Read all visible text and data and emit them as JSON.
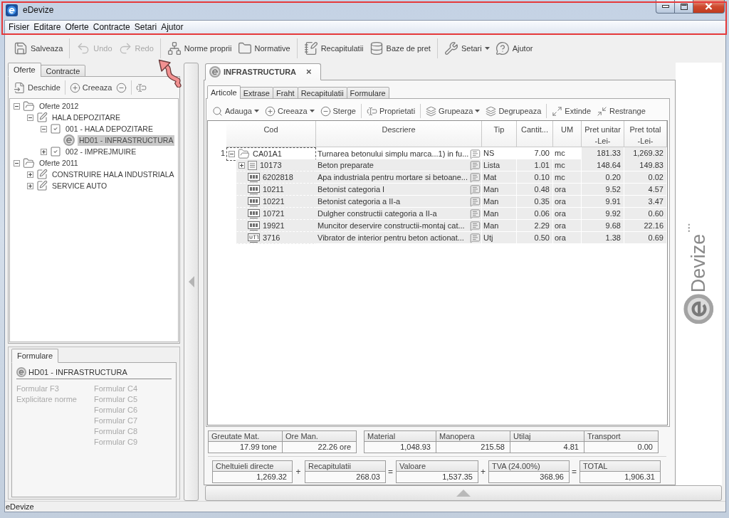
{
  "window": {
    "title": "eDevize"
  },
  "menu": [
    {
      "label": "Fisier"
    },
    {
      "label": "Editare"
    },
    {
      "label": "Oferte"
    },
    {
      "label": "Contracte"
    },
    {
      "label": "Setari"
    },
    {
      "label": "Ajutor"
    }
  ],
  "toolbar": [
    [
      {
        "label": "Salveaza",
        "disabled": false,
        "dropdown": false
      }
    ],
    [
      {
        "label": "Undo",
        "disabled": true,
        "dropdown": false
      },
      {
        "label": "Redo",
        "disabled": true,
        "dropdown": false
      }
    ],
    [
      {
        "label": "Norme proprii",
        "disabled": false,
        "dropdown": false
      },
      {
        "label": "Normative",
        "disabled": false,
        "dropdown": false
      }
    ],
    [
      {
        "label": "Recapitulatii",
        "disabled": false,
        "dropdown": false
      },
      {
        "label": "Baze de pret",
        "disabled": false,
        "dropdown": false
      }
    ],
    [
      {
        "label": "Setari",
        "disabled": false,
        "dropdown": true
      },
      {
        "label": "Ajutor",
        "disabled": false,
        "dropdown": false
      }
    ]
  ],
  "offers_panel": {
    "tabs": [
      {
        "label": "Oferte",
        "selected": true
      },
      {
        "label": "Contracte",
        "selected": false
      }
    ],
    "toolbar": [
      {
        "label": "Deschide"
      },
      {
        "label": "Creeaza"
      }
    ],
    "tree": [
      {
        "label": "Oferte 2012",
        "kind": "folder",
        "expanded": true,
        "selected": false,
        "children": [
          {
            "label": "HALA DEPOZITARE",
            "kind": "project",
            "expanded": true,
            "selected": false,
            "children": [
              {
                "label": "001 - HALA DEPOZITARE",
                "kind": "offer",
                "expanded": true,
                "selected": false,
                "children": [
                  {
                    "label": "HD01 - INFRASTRUCTURA",
                    "kind": "estimate",
                    "selected": true
                  }
                ]
              },
              {
                "label": "002 - IMPREJMUIRE",
                "kind": "offer",
                "expanded": false,
                "selected": false
              }
            ]
          }
        ]
      },
      {
        "label": "Oferte 2011",
        "kind": "folder",
        "expanded": true,
        "selected": false,
        "children": [
          {
            "label": "CONSTRUIRE HALA INDUSTRIALA",
            "kind": "project",
            "expanded": false,
            "selected": false
          },
          {
            "label": "SERVICE AUTO",
            "kind": "project",
            "expanded": false,
            "selected": false
          }
        ]
      }
    ]
  },
  "forms_panel": {
    "tabs": [
      {
        "label": "Formulare",
        "selected": true
      }
    ],
    "title": "HD01 - INFRASTRUCTURA",
    "columns": [
      [
        {
          "label": "Formular F3",
          "disabled": true
        },
        {
          "label": "Explicitare norme",
          "disabled": true
        }
      ],
      [
        {
          "label": "Formular C4",
          "disabled": true
        },
        {
          "label": "Formular C5",
          "disabled": true
        },
        {
          "label": "Formular C6",
          "disabled": true
        },
        {
          "label": "Formular C7",
          "disabled": true
        },
        {
          "label": "Formular C8",
          "disabled": true
        },
        {
          "label": "Formular C9",
          "disabled": true
        }
      ]
    ]
  },
  "document_tabs": [
    {
      "label": "INFRASTRUCTURA",
      "close": "×",
      "selected": true
    }
  ],
  "sheet_tabs": [
    {
      "label": "Articole",
      "selected": true
    },
    {
      "label": "Extrase",
      "selected": false
    },
    {
      "label": "Fraht",
      "selected": false
    },
    {
      "label": "Recapitulatii",
      "selected": false
    },
    {
      "label": "Formulare",
      "selected": false
    }
  ],
  "sheet_toolbar": [
    [
      {
        "label": "Adauga",
        "dropdown": true
      },
      {
        "label": "Creeaza",
        "dropdown": true
      },
      {
        "label": "Sterge",
        "dropdown": false
      }
    ],
    [
      {
        "label": "Proprietati",
        "dropdown": false
      }
    ],
    [
      {
        "label": "Grupeaza",
        "dropdown": true
      },
      {
        "label": "Degrupeaza",
        "dropdown": false
      }
    ],
    [
      {
        "label": "Extinde",
        "dropdown": false
      },
      {
        "label": "Restrange",
        "dropdown": false
      }
    ]
  ],
  "table": {
    "columns": [
      {
        "label": "Cod"
      },
      {
        "label": "Descriere"
      },
      {
        "label": "Tip"
      },
      {
        "label": "Cantit..."
      },
      {
        "label": "UM"
      },
      {
        "label": "Pret unitar",
        "unit": "-Lei-"
      },
      {
        "label": "Pret total",
        "unit": "-Lei-"
      }
    ],
    "rows": [
      {
        "number": "1",
        "kind": "article",
        "expanded": true,
        "focused": true,
        "cod": "CA01A1",
        "descriere": "Turnarea betonului simplu marca...1) in fu...",
        "tip": "NS",
        "cantitate": "7.00",
        "um": "mc",
        "pret_unitar": "181.33",
        "pret_total": "1,269.32",
        "children": [
          {
            "kind": "list",
            "expanded": false,
            "focused": false,
            "cod": "10173",
            "descriere": "Beton preparate",
            "tip": "Lista",
            "cantitate": "1.01",
            "um": "mc",
            "pret_unitar": "148.64",
            "pret_total": "149.83"
          },
          {
            "kind": "resource",
            "focused": false,
            "cod": "6202818",
            "descriere": "Apa industriala pentru mortare si betoane...",
            "tip": "Mat",
            "cantitate": "0.10",
            "um": "mc",
            "pret_unitar": "0.20",
            "pret_total": "0.02"
          },
          {
            "kind": "resource",
            "focused": false,
            "cod": "10211",
            "descriere": "Betonist categoria I",
            "tip": "Man",
            "cantitate": "0.48",
            "um": "ora",
            "pret_unitar": "9.52",
            "pret_total": "4.57"
          },
          {
            "kind": "resource",
            "focused": false,
            "cod": "10221",
            "descriere": "Betonist categoria a II-a",
            "tip": "Man",
            "cantitate": "0.35",
            "um": "ora",
            "pret_unitar": "9.91",
            "pret_total": "3.47"
          },
          {
            "kind": "resource",
            "focused": false,
            "cod": "10721",
            "descriere": "Dulgher constructii categoria a II-a",
            "tip": "Man",
            "cantitate": "0.06",
            "um": "ora",
            "pret_unitar": "9.92",
            "pret_total": "0.60"
          },
          {
            "kind": "resource",
            "focused": false,
            "cod": "19921",
            "descriere": "Muncitor deservire constructii-montaj cat...",
            "tip": "Man",
            "cantitate": "2.29",
            "um": "ora",
            "pret_unitar": "9.68",
            "pret_total": "22.16"
          },
          {
            "kind": "equipment",
            "focused": false,
            "cod": "3716",
            "descriere": "Vibrator de interior pentru beton actionat...",
            "tip": "Utj",
            "cantitate": "0.50",
            "um": "ora",
            "pret_unitar": "1.38",
            "pret_total": "0.69"
          }
        ]
      }
    ]
  },
  "summary": {
    "quantities": [
      {
        "label": "Greutate Mat.",
        "value": "17.99 tone"
      },
      {
        "label": "Ore Man.",
        "value": "22.26 ore"
      }
    ],
    "costs": [
      {
        "label": "Material",
        "value": "1,048.93"
      },
      {
        "label": "Manopera",
        "value": "215.58"
      },
      {
        "label": "Utilaj",
        "value": "4.81"
      },
      {
        "label": "Transport",
        "value": "0.00"
      }
    ],
    "calculation": [
      {
        "kind": "box",
        "label": "Cheltuieli directe",
        "value": "1,269.32"
      },
      {
        "kind": "operator",
        "sign": "+"
      },
      {
        "kind": "box",
        "label": "Recapitulatii",
        "value": "268.03"
      },
      {
        "kind": "operator",
        "sign": "="
      },
      {
        "kind": "box",
        "label": "Valoare",
        "value": "1,537.35"
      },
      {
        "kind": "operator",
        "sign": "+"
      },
      {
        "kind": "box",
        "label": "TVA (24.00%)",
        "value": "368.96"
      },
      {
        "kind": "operator",
        "sign": "="
      },
      {
        "kind": "box",
        "label": "TOTAL",
        "value": "1,906.31"
      }
    ]
  },
  "logo": {
    "text": "Devize"
  },
  "status_bar": {
    "text": "eDevize"
  }
}
